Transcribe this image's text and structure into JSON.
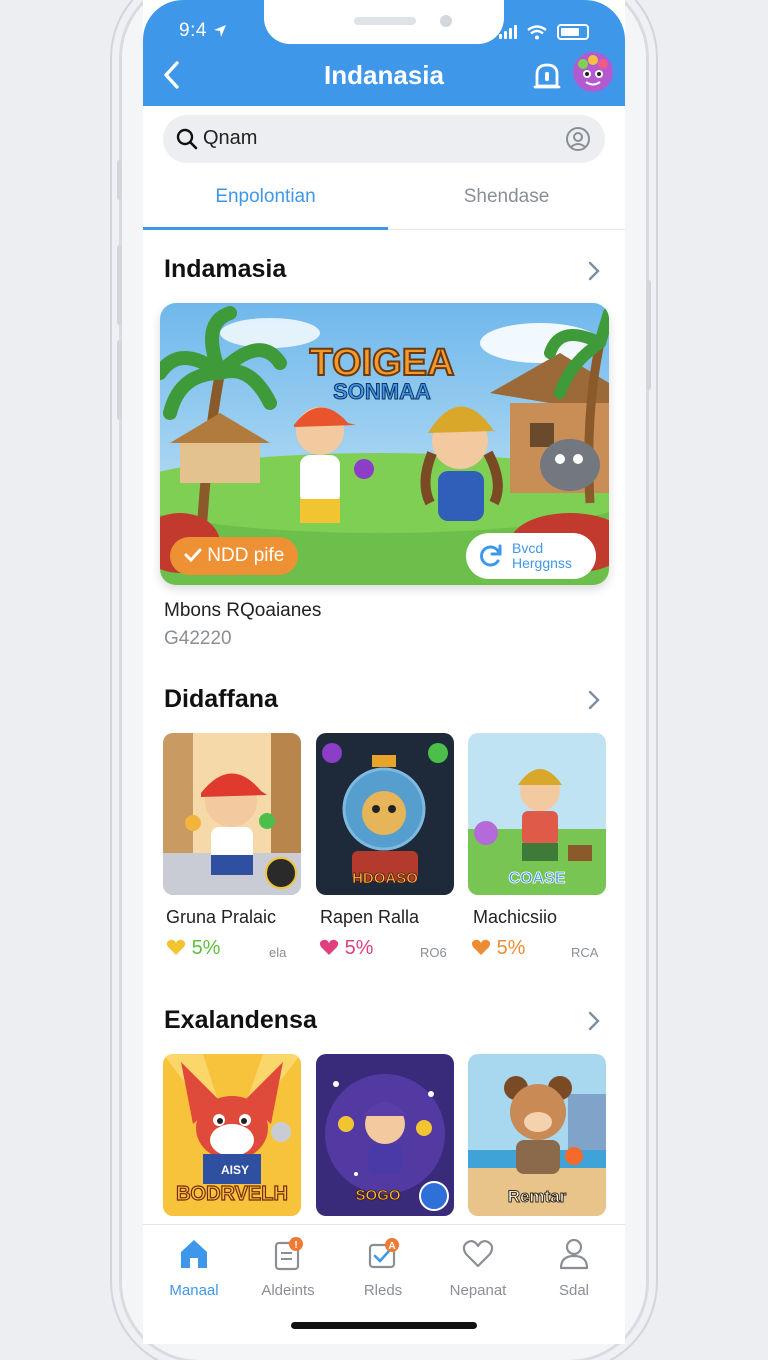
{
  "status_bar": {
    "time": "9:4"
  },
  "header": {
    "title": "Indanasia"
  },
  "search": {
    "query": "Qnam"
  },
  "tabs": [
    {
      "label": "Enpolontian",
      "active": true
    },
    {
      "label": "Shendase",
      "active": false
    }
  ],
  "sections": {
    "featured": {
      "title": "Indamasia",
      "hero_logo": [
        "TOIGEA",
        "SONMAA"
      ],
      "badge_left": "NDD pife",
      "badge_right": [
        "Bvcd",
        "Herggnss"
      ],
      "caption": "Mbons RQoaianes",
      "subcaption": "G42220"
    },
    "second": {
      "title": "Didaffana",
      "cards": [
        {
          "name": "Gruna Pralaic",
          "rating": "5%",
          "meta": "ela",
          "icon": "yellow-heart-icon",
          "rating_color": "#5cbf3a",
          "heart_color": "#f2c431"
        },
        {
          "name": "Rapen Ralla",
          "rating": "5%",
          "meta": "RO6",
          "icon": "pink-heart-icon",
          "rating_color": "#e0407e",
          "heart_color": "#e0407e",
          "logo": "HDOASO"
        },
        {
          "name": "Machicsiio",
          "rating": "5%",
          "meta": "RCA",
          "icon": "orange-heart-icon",
          "rating_color": "#ee8c34",
          "heart_color": "#ee8c34",
          "logo": "COASE"
        }
      ]
    },
    "third": {
      "title": "Exalandensa",
      "cards": [
        {
          "logo": "BODRVELH",
          "sign": "AISY"
        },
        {
          "logo": "SOGO"
        },
        {
          "logo": "Remtar"
        }
      ]
    }
  },
  "bottom_nav": [
    {
      "label": "Manaal",
      "icon": "home-icon",
      "active": true
    },
    {
      "label": "Aldeints",
      "icon": "clipboard-icon",
      "active": false
    },
    {
      "label": "Rleds",
      "icon": "checkbox-icon",
      "active": false
    },
    {
      "label": "Nepanat",
      "icon": "heart-icon",
      "active": false
    },
    {
      "label": "Sdal",
      "icon": "person-icon",
      "active": false
    }
  ],
  "colors": {
    "accent": "#3f97ea",
    "badge_orange": "#ee9134"
  }
}
